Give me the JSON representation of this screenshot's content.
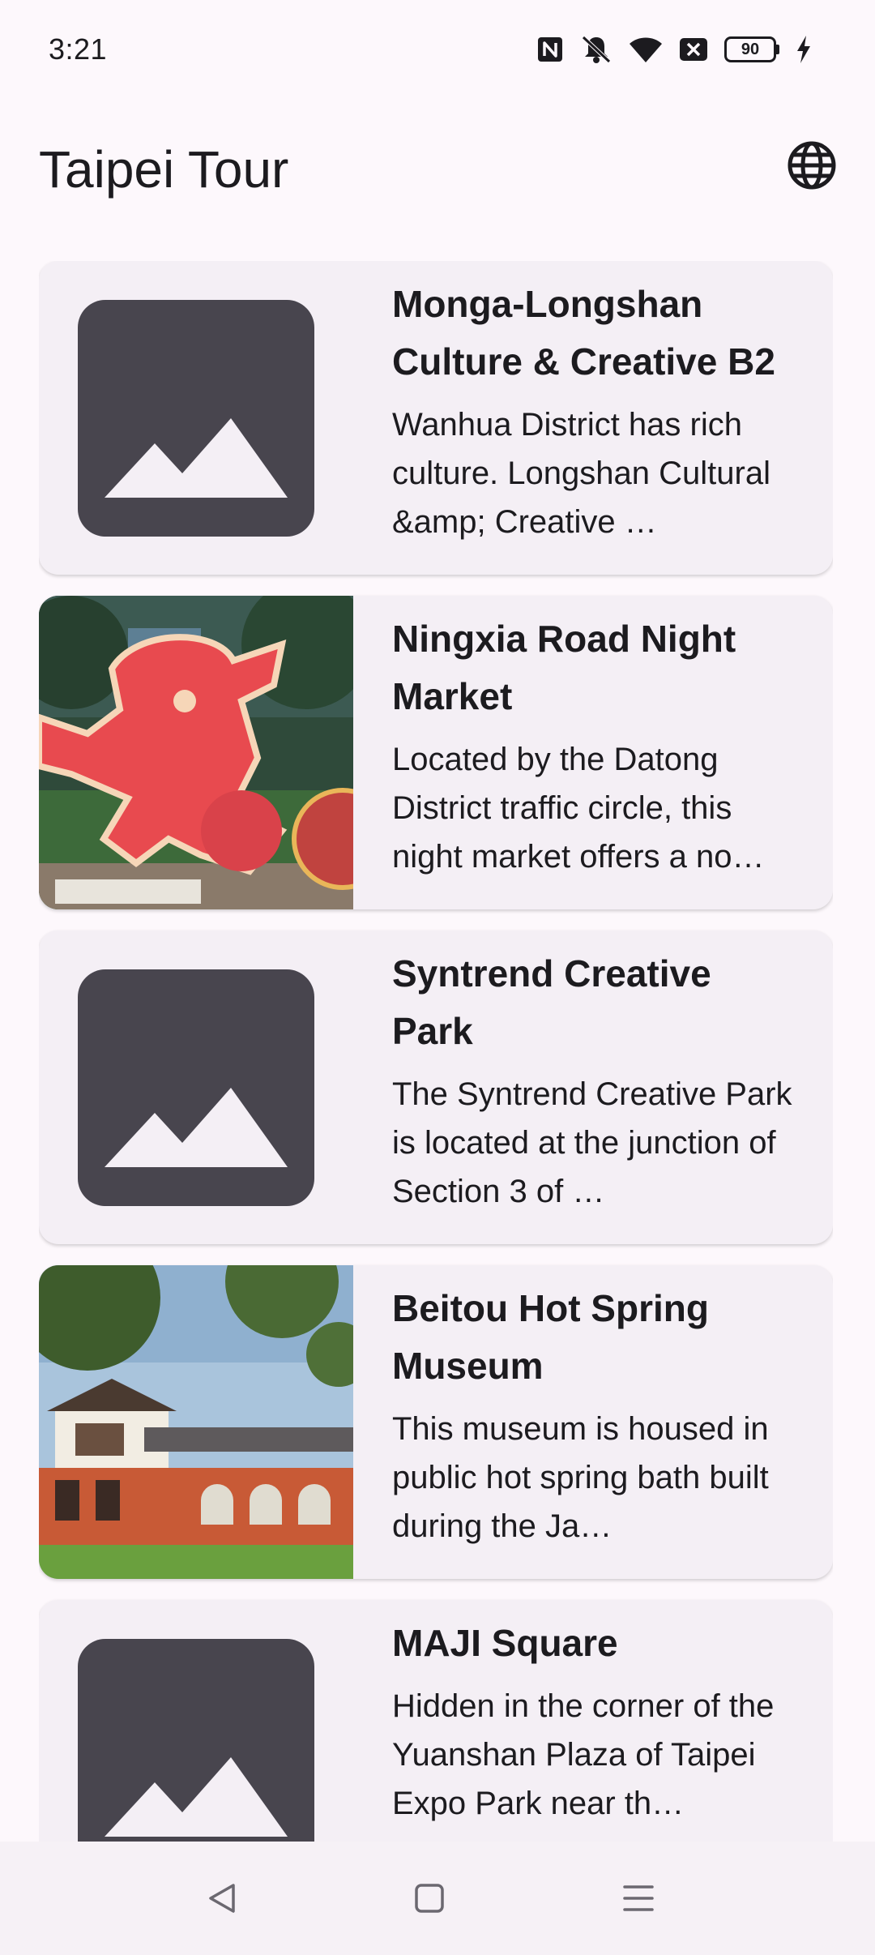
{
  "status_bar": {
    "time": "3:21",
    "battery_level": "90",
    "icons": [
      "nfc-icon",
      "bell-muted-icon",
      "wifi-icon",
      "close-box-icon",
      "battery-icon",
      "charging-icon"
    ]
  },
  "header": {
    "title": "Taipei Tour",
    "language_icon": "globe-icon"
  },
  "attractions": [
    {
      "title": "Monga-Longshan Culture & Creative B2",
      "description": "Wanhua District has rich culture. Longshan Cultural &amp; Creative …",
      "image": "placeholder"
    },
    {
      "title": "Ningxia Road Night Market",
      "description": "Located by the Datong District traffic circle, this night market offers a no…",
      "image": "photo-dragon-sculpture"
    },
    {
      "title": "Syntrend Creative Park",
      "description": "The Syntrend Creative Park is located at the junction of Section 3 of …",
      "image": "placeholder"
    },
    {
      "title": "Beitou Hot Spring Museum",
      "description": "This museum is housed in public hot spring bath built during the Ja…",
      "image": "photo-museum-building"
    },
    {
      "title": "MAJI Square",
      "description": "Hidden in the corner of the Yuanshan Plaza of Taipei Expo Park near th…",
      "image": "placeholder"
    }
  ],
  "nav_bar": {
    "back_icon": "back-triangle-icon",
    "home_icon": "home-square-icon",
    "menu_icon": "menu-lines-icon"
  },
  "colors": {
    "background": "#fdf8fc",
    "card": "#f4eff5",
    "placeholder": "#48454e",
    "text": "#1c1b1f"
  }
}
